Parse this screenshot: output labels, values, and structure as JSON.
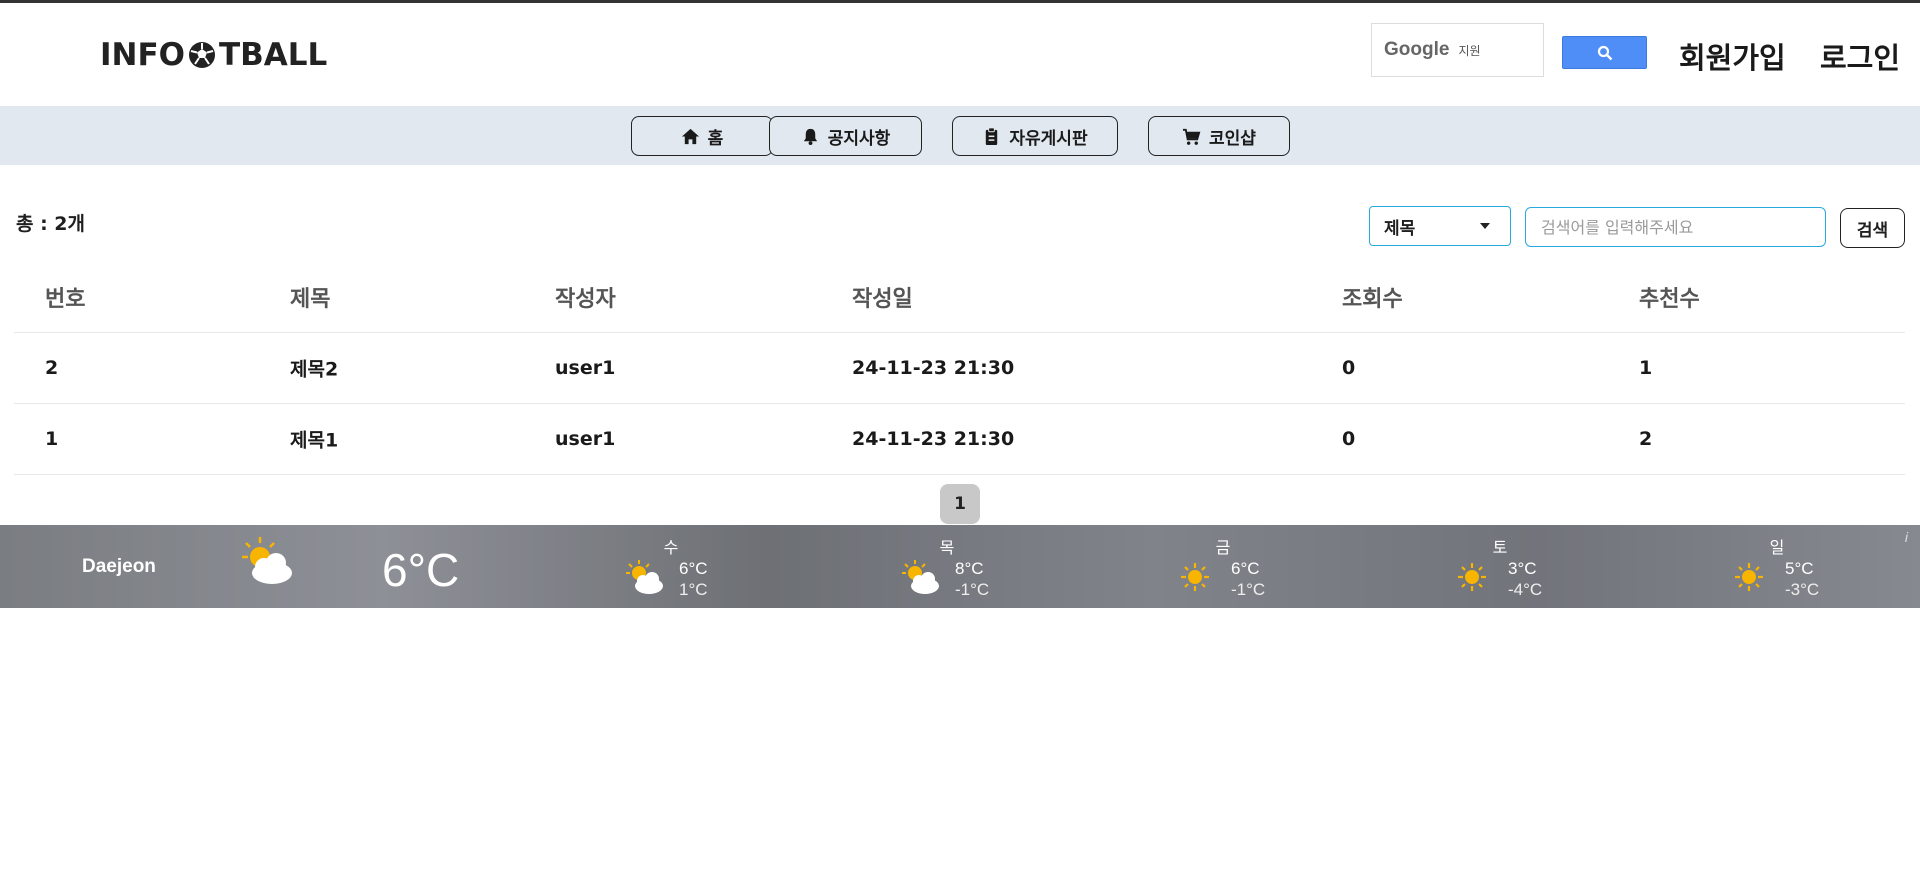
{
  "header": {
    "logo_text_left": "INFO",
    "logo_text_right": "TBALL",
    "google_logo": "Google",
    "google_sub": "지원",
    "signup_label": "회원가입",
    "login_label": "로그인"
  },
  "nav": {
    "items": [
      {
        "label": "홈",
        "icon": "home-icon"
      },
      {
        "label": "공지사항",
        "icon": "bell-icon"
      },
      {
        "label": "자유게시판",
        "icon": "clipboard-icon"
      },
      {
        "label": "코인샵",
        "icon": "cart-icon"
      }
    ]
  },
  "list": {
    "total_label": "총 : 2개",
    "search_type": "제목",
    "search_placeholder": "검색어를 입력해주세요",
    "search_button": "검색"
  },
  "table": {
    "headers": [
      "번호",
      "제목",
      "작성자",
      "작성일",
      "조회수",
      "추천수"
    ],
    "rows": [
      [
        "2",
        "제목2",
        "user1",
        "24-11-23 21:30",
        "0",
        "1"
      ],
      [
        "1",
        "제목1",
        "user1",
        "24-11-23 21:30",
        "0",
        "2"
      ]
    ]
  },
  "pagination": {
    "current": "1"
  },
  "weather": {
    "city": "Daejeon",
    "now_temp": "6°C",
    "now_icon": "partly-cloudy-icon",
    "info": "i",
    "days": [
      {
        "name": "수",
        "hi": "6°C",
        "lo": "1°C",
        "icon": "partly-cloudy-icon"
      },
      {
        "name": "목",
        "hi": "8°C",
        "lo": "-1°C",
        "icon": "partly-cloudy-icon"
      },
      {
        "name": "금",
        "hi": "6°C",
        "lo": "-1°C",
        "icon": "sun-icon"
      },
      {
        "name": "토",
        "hi": "3°C",
        "lo": "-4°C",
        "icon": "sun-icon"
      },
      {
        "name": "일",
        "hi": "5°C",
        "lo": "-3°C",
        "icon": "sun-icon"
      }
    ]
  },
  "colors": {
    "nav_bg": "#e1e8f0",
    "accent_blue": "#29a9e0",
    "google_btn": "#4f8ef7",
    "sun": "#f7b500"
  }
}
